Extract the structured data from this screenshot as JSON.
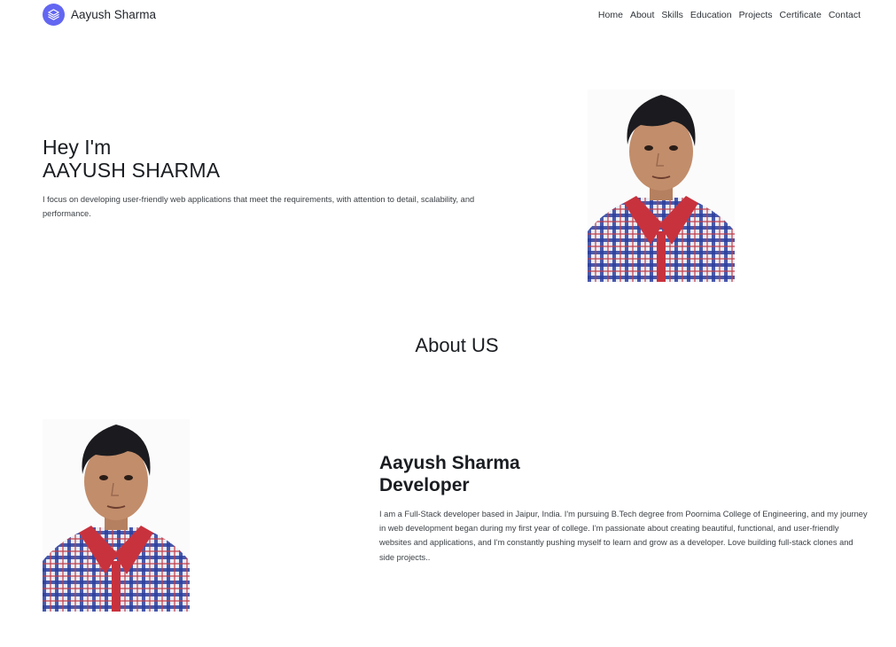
{
  "brand": {
    "name": "Aayush Sharma",
    "logo_icon": "layers-icon",
    "logo_color": "#6366f1"
  },
  "nav": {
    "items": [
      "Home",
      "About",
      "Skills",
      "Education",
      "Projects",
      "Certificate",
      "Contact"
    ]
  },
  "hero": {
    "greeting": "Hey I'm",
    "name": "AAYUSH SHARMA",
    "description": "I focus on developing user-friendly web applications that meet the requirements, with attention to detail, scalability, and performance.",
    "photo_alt": "profile-photo"
  },
  "about": {
    "section_title": "About US",
    "name": "Aayush Sharma",
    "role": "Developer",
    "description": "I am a Full-Stack developer based in Jaipur, India. I'm pursuing B.Tech degree from Poornima College of Engineering, and my journey in web development began during my first year of college. I'm passionate about creating beautiful, functional, and user-friendly websites and applications, and I'm constantly pushing myself to learn and grow as a developer. Love building full-stack clones and side projects.."
  }
}
